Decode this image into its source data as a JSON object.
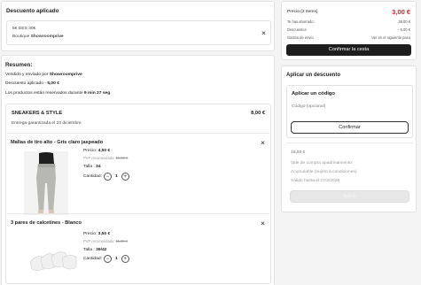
{
  "discount": {
    "title": "Descuento aplicado",
    "code": "5€ DES 30€",
    "boutique_prefix": "Boutique ",
    "boutique_name": "Showroomprive"
  },
  "summary": {
    "title": "Resumen:",
    "sold_by_prefix": "Vendido y enviado por ",
    "sold_by": "Showroomprive",
    "discount_prefix": "Descuento aplicado - ",
    "discount_value": "5,00 €",
    "reserved_prefix": "Los productos están reservados durante ",
    "reserved_time": "9 min 27 seg",
    "reserved_suffix": "."
  },
  "shipment": {
    "brand": "SNEAKERS & STYLE",
    "total": "8,00 €",
    "delivery": "Entrega garantizada el 23 diciembre"
  },
  "items": [
    {
      "name": "Mallas de tiro alto - Gris claro jaspeado",
      "price_label": "Precio: ",
      "price": "4,50 €",
      "rrp_label": "PVP recomendado: ",
      "rrp": "15,00 €",
      "size_label": "Talla : ",
      "size": "34",
      "qty_label": "Cantidad: ",
      "qty": "1"
    },
    {
      "name": "3 pares de calcetines - Blanco",
      "price_label": "Precio: ",
      "price": "3,50 €",
      "rrp_label": "PVP recomendado: ",
      "rrp": "11,00 €",
      "size_label": "Talla : ",
      "size": "39/42",
      "qty_label": "Cantidad: ",
      "qty": "1"
    }
  ],
  "totals": {
    "price_label": "Precio (2 Items)",
    "price_value": "3,00 €",
    "saved_label": "Te has ahorrado:",
    "saved_value": "38,00 €",
    "discounts_label": "Descuentos",
    "discounts_value": "- 5,00 €",
    "shipping_label": "Gastos de envío",
    "shipping_value": "Ver en el siguiente paso",
    "confirm_button": "Confirmar la cesta"
  },
  "apply_discount": {
    "title": "Aplicar un descuento",
    "code_title": "Aplicar un código",
    "code_placeholder": "Código (opcional)",
    "confirm_button": "Confirmar",
    "voucher_amount": "15,00 €",
    "voucher_desc": "Vale de compra apadrinamiento",
    "voucher_note": "Acumulable (sujeto a condiciones)",
    "voucher_valid": "Válido hasta el 27/3/2026",
    "voucher_button": "Aplicar"
  },
  "colors": {
    "accent_red": "#d6282b",
    "dark_button": "#1d1d1d"
  },
  "icons": [
    "close-icon",
    "minus-icon",
    "plus-icon"
  ]
}
